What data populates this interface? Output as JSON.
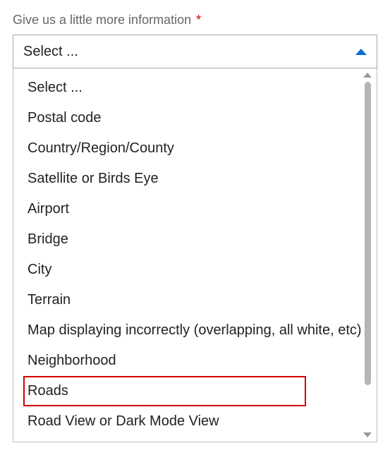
{
  "field": {
    "label": "Give us a little more information",
    "required_marker": "*"
  },
  "select": {
    "value": "Select ..."
  },
  "options": [
    "Select ...",
    "Postal code",
    "Country/Region/County",
    "Satellite or Birds Eye",
    "Airport",
    "Bridge",
    "City",
    "Terrain",
    "Map displaying incorrectly (overlapping, all white, etc)",
    "Neighborhood",
    "Roads",
    "Road View or Dark Mode View"
  ],
  "highlighted_index": 10
}
